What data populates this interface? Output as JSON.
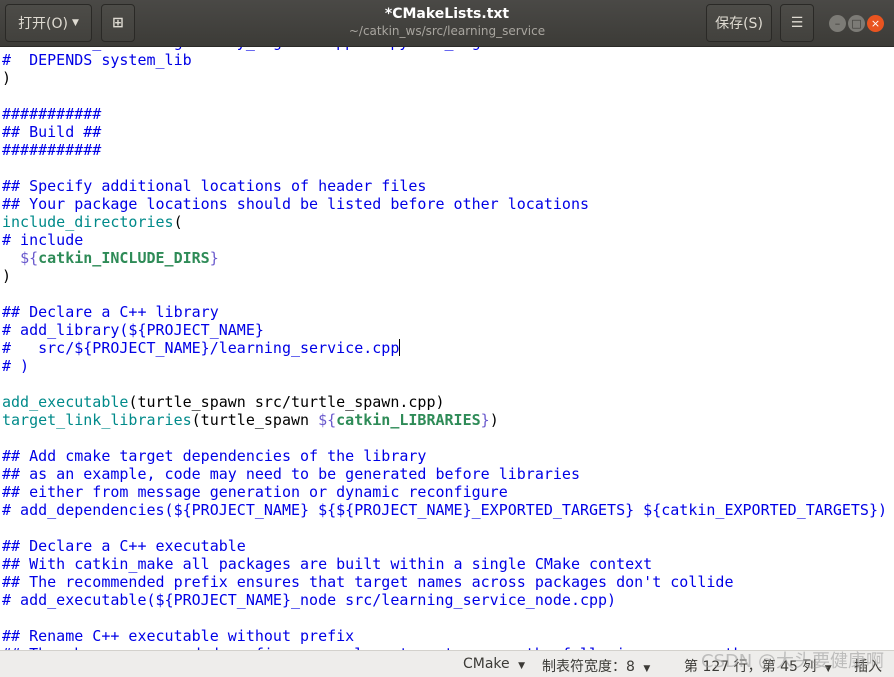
{
  "header": {
    "open_label": "打开(O)",
    "title": "*CMakeLists.txt",
    "subtitle": "~/catkin_ws/src/learning_service",
    "save_label": "保存(S)"
  },
  "editor": {
    "lines": [
      [
        [
          "cm",
          "#   catkin_DEPENDS geometry_msgs roscpp rospy std_msgs turtlesim"
        ]
      ],
      [
        [
          "cm",
          "#  DEPENDS system_lib"
        ]
      ],
      [
        [
          "tx",
          ")"
        ]
      ],
      [],
      [
        [
          "cm",
          "###########"
        ]
      ],
      [
        [
          "cm",
          "## Build ##"
        ]
      ],
      [
        [
          "cm",
          "###########"
        ]
      ],
      [],
      [
        [
          "cm",
          "## Specify additional locations of header files"
        ]
      ],
      [
        [
          "cm",
          "## Your package locations should be listed before other locations"
        ]
      ],
      [
        [
          "fn",
          "include_directories"
        ],
        [
          "tx",
          "("
        ]
      ],
      [
        [
          "cm",
          "# include"
        ]
      ],
      [
        [
          "tx",
          "  "
        ],
        [
          "dl",
          "${"
        ],
        [
          "vr",
          "catkin_INCLUDE_DIRS"
        ],
        [
          "dl",
          "}"
        ]
      ],
      [
        [
          "tx",
          ")"
        ]
      ],
      [],
      [
        [
          "cm",
          "## Declare a C++ library"
        ]
      ],
      [
        [
          "cm",
          "# add_library(${PROJECT_NAME}"
        ]
      ],
      [
        [
          "cm",
          "#   src/${PROJECT_NAME}/learning_service.cpp"
        ],
        [
          "cursor",
          ""
        ]
      ],
      [
        [
          "cm",
          "# )"
        ]
      ],
      [],
      [
        [
          "fn",
          "add_executable"
        ],
        [
          "tx",
          "(turtle_spawn src/turtle_spawn.cpp)"
        ]
      ],
      [
        [
          "fn",
          "target_link_libraries"
        ],
        [
          "tx",
          "(turtle_spawn "
        ],
        [
          "dl",
          "${"
        ],
        [
          "vr",
          "catkin_LIBRARIES"
        ],
        [
          "dl",
          "}"
        ],
        [
          "tx",
          ")"
        ]
      ],
      [],
      [
        [
          "cm",
          "## Add cmake target dependencies of the library"
        ]
      ],
      [
        [
          "cm",
          "## as an example, code may need to be generated before libraries"
        ]
      ],
      [
        [
          "cm",
          "## either from message generation or dynamic reconfigure"
        ]
      ],
      [
        [
          "cm",
          "# add_dependencies(${PROJECT_NAME} ${${PROJECT_NAME}_EXPORTED_TARGETS} ${catkin_EXPORTED_TARGETS})"
        ]
      ],
      [],
      [
        [
          "cm",
          "## Declare a C++ executable"
        ]
      ],
      [
        [
          "cm",
          "## With catkin_make all packages are built within a single CMake context"
        ]
      ],
      [
        [
          "cm",
          "## The recommended prefix ensures that target names across packages don't collide"
        ]
      ],
      [
        [
          "cm",
          "# add_executable(${PROJECT_NAME}_node src/learning_service_node.cpp)"
        ]
      ],
      [],
      [
        [
          "cm",
          "## Rename C++ executable without prefix"
        ]
      ],
      [
        [
          "cm",
          "## The above recommended prefix causes long target names, the following renames the"
        ]
      ]
    ]
  },
  "status": {
    "language": "CMake",
    "tab_width": "制表符宽度：8",
    "position": "第 127 行，第 45 列",
    "mode": "插入"
  },
  "watermark": "CSDN @大头要健康啊"
}
